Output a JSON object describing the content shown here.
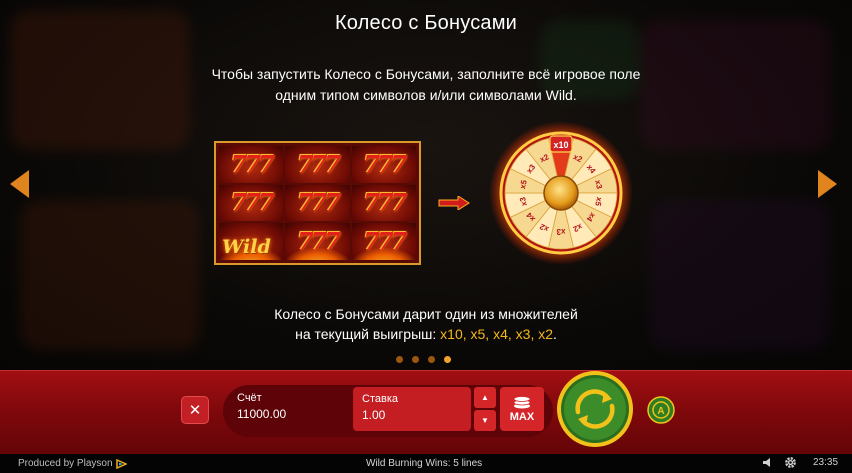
{
  "rules_page": {
    "title": "Колесо с Бонусами",
    "instruction_line1": "Чтобы запустить Колесо с Бонусами, заполните всё игровое поле",
    "instruction_line2": "одним типом символов и/или символами Wild.",
    "description_line1": "Колесо с Бонусами дарит один из множителей",
    "description_prefix": "на текущий выигрыш: ",
    "description_multipliers": "x10, x5, x4, x3, x2",
    "description_suffix": ".",
    "page_dots": 4,
    "active_dot": 4
  },
  "reels": {
    "symbol_text": "777",
    "wild_text": "Wild"
  },
  "wheel": {
    "top_label": "x10",
    "segments": [
      "x10",
      "x2",
      "x4",
      "x3",
      "x5",
      "x4",
      "x2",
      "x3",
      "x2",
      "x4",
      "x3",
      "x5",
      "x3",
      "x2"
    ]
  },
  "controls": {
    "close_label": "✕",
    "balance_label": "Счёт",
    "balance_value": "11000.00",
    "bet_label": "Ставка",
    "bet_value": "1.00",
    "step_up": "▲",
    "step_down": "▼",
    "max_label": "MAX",
    "auto_label": "A"
  },
  "footer": {
    "produced_by": "Produced by Playson",
    "lines_info": "Wild Burning Wins: 5 lines",
    "clock": "23:35"
  },
  "colors": {
    "accent_orange": "#e0841d",
    "multiplier_gold": "#f4b81c",
    "panel_red": "#8e0a0e",
    "spin_green": "#3d8c2a"
  },
  "icons": {
    "left": "chevron-left-icon",
    "right": "chevron-right-icon",
    "arrow": "arrow-right-icon",
    "coins": "coins-icon",
    "spin": "spin-icon",
    "auto": "autoplay-icon",
    "speaker": "speaker-icon",
    "settings": "gear-icon",
    "logo": "playson-logo-icon"
  }
}
